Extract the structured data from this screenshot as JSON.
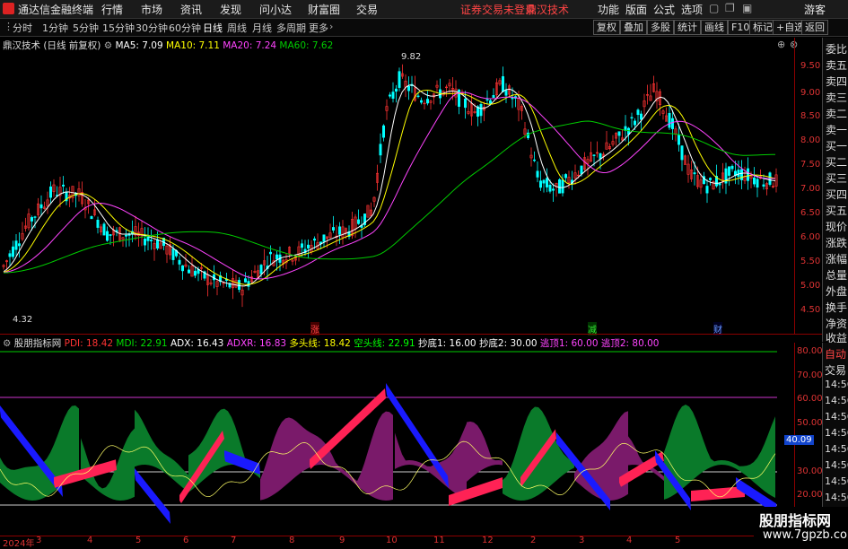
{
  "menubar": {
    "app_title": "通达信金融终端",
    "menus": [
      "行情",
      "市场",
      "资讯",
      "发现",
      "问小达",
      "财富圈",
      "交易"
    ],
    "status": "证券交易未登录",
    "brand": "鼎汉技术",
    "right": [
      "功能",
      "版面",
      "公式",
      "选项"
    ],
    "guest": "游客"
  },
  "periods": [
    "分时",
    "1分钟",
    "5分钟",
    "15分钟",
    "30分钟",
    "60分钟",
    "日线",
    "周线",
    "月线",
    "多周期",
    "更多"
  ],
  "active_period": "日线",
  "right_buttons": [
    "复权",
    "叠加",
    "多股",
    "统计",
    "画线",
    "F10",
    "标记",
    "+自选",
    "返回"
  ],
  "main_legend": {
    "name": "鼎汉技术",
    "desc": "(日线 前复权)",
    "ma5": "MA5: 7.09",
    "ma10": "MA10: 7.11",
    "ma20": "MA20: 7.24",
    "ma60": "MA60: 7.62"
  },
  "price_ticks": [
    "9.50",
    "9.00",
    "8.50",
    "8.00",
    "7.50",
    "7.00",
    "6.50",
    "6.00",
    "5.50",
    "5.00",
    "4.50"
  ],
  "high_label": "9.82",
  "low_label": "4.32",
  "markers": {
    "up": "涨",
    "down": "减",
    "fin": "财"
  },
  "right_tabs": [
    "委比",
    "卖五",
    "卖四",
    "卖三",
    "卖二",
    "卖一",
    "买一",
    "买二",
    "买三",
    "买四",
    "买五",
    "现价",
    "涨跌",
    "涨幅",
    "总量",
    "外盘",
    "换手",
    "净资",
    "收益"
  ],
  "right_tabs2": [
    "自动",
    "交易",
    "14:56",
    "14:56",
    "14:56",
    "14:56",
    "14:56",
    "14:56",
    "14:56",
    "14:56"
  ],
  "indicator_legend": {
    "name": "股朋指标网",
    "pdi": "PDI: 18.42",
    "mdi": "MDI: 22.91",
    "adx": "ADX: 16.43",
    "adxr": "ADXR: 16.83",
    "long": "多头线: 18.42",
    "short": "空头线: 22.91",
    "bottom1": "抄底1: 16.00",
    "bottom2": "抄底2: 30.00",
    "top1": "逃顶1: 60.00",
    "top2": "逃顶2: 80.00"
  },
  "indicator_ticks": [
    "80.00",
    "70.00",
    "60.00",
    "50.00",
    "30.00",
    "20.00"
  ],
  "indicator_current": "40.09",
  "x_labels": [
    "2024年",
    "3",
    "4",
    "5",
    "6",
    "7",
    "8",
    "9",
    "10",
    "11",
    "12",
    "2",
    "3",
    "4",
    "5"
  ],
  "watermark": {
    "line1": "股朋指标网",
    "line2": "www.7gpzb.com"
  },
  "colors": {
    "up": "#ff3333",
    "down": "#00ffff",
    "ma5": "#ffffff",
    "ma10": "#ffff00",
    "ma20": "#ff44ff",
    "ma60": "#00cc00"
  }
}
